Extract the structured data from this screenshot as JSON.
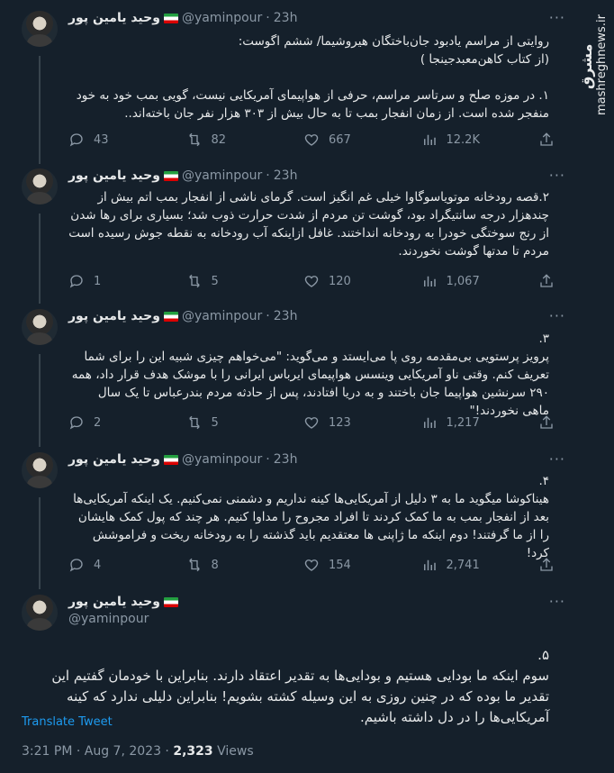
{
  "side_logo": {
    "site": "mashreghnews.ir",
    "brand": "مشرق"
  },
  "author": {
    "name": "وحید یامین پور",
    "handle": "@yaminpour",
    "time": "23h"
  },
  "tweets": [
    {
      "text": "روایتی از مراسم یادبود جان‌باختگان هیروشیما/ ششم اگوست:\n(از کتاب کاهن‌معبدجینجا )\n\n۱. در موزه صلح و سرتاسر مراسم، حرفی از هواپیمای آمریکایی نیست، گویی بمب خود به خود منفجر شده است. از زمان انفجار بمب تا به حال بیش از ۳۰۳ هزار نفر جان باخته‌اند..",
      "replies": "43",
      "retweets": "82",
      "likes": "667",
      "views": "12.2K"
    },
    {
      "text": "۲.قصه رودخانه موتویاسوگاوا خیلی غم انگیز است. گرمای ناشی از انفجار بمب اتم بیش از چندهزار درجه سانتیگراد بود، گوشت تن مردم از شدت حرارت ذوب شد؛ بسیاری برای رها شدن از رنج سوختگی خودرا به رودخانه انداختند. غافل ازاینکه آب رودخانه به نقطه جوش رسیده است\nمردم تا مدتها گوشت نخوردند.",
      "replies": "1",
      "retweets": "5",
      "likes": "120",
      "views": "1,067"
    },
    {
      "text": "۳.\nپرویز پرستویی بی‌مقدمه روی پا می‌ایستد و می‌گوید: \"می‌خواهم چیزی شبیه این را برای شما تعریف کنم. وقتی ناو آمریکایی وینسس هواپیمای ایرباس ایرانی را با موشک هدف قرار داد، همه ۲۹۰ سرنشین هواپیما جان باختند و به دریا افتادند، پس از حادثه مردم بندرعباس تا یک سال ماهی نخوردند!\"",
      "replies": "2",
      "retweets": "5",
      "likes": "123",
      "views": "1,217"
    },
    {
      "text": "۴.\nهیناکوشا میگوید ما به ۳ دلیل از آمریکایی‌ها کینه نداریم و دشمنی نمی‌کنیم. یک اینکه آمریکایی‌ها بعد از انفجار بمب به ما کمک کردند تا افراد مجروح را مداوا کنیم. هر چند که پول کمک هایشان را از ما گرفتند! دوم اینکه ما ژاپنی ها معتقدیم باید گذشته را به رودخانه ریخت و فراموشش کرد!",
      "replies": "4",
      "retweets": "8",
      "likes": "154",
      "views": "2,741"
    }
  ],
  "final": {
    "text": "۵.\nسوم اینکه ما بودایی هستیم و بودایی‌ها به تقدیر اعتقاد دارند. بنابراین با خودمان گفتیم این تقدیر ما بوده که در چنین روزی به این وسیله کشته بشویم! بنابراین دلیلی ندارد که کینه آمریکایی‌ها را در دل داشته باشیم.",
    "translate": "Translate Tweet",
    "date": "3:21 PM · Aug 7, 2023 · ",
    "views_count": "2,323",
    "views_label": " Views"
  },
  "colors": {
    "background": "#15202b",
    "text": "#e7e9ea",
    "muted": "#8b98a5",
    "link": "#1d9bf0"
  }
}
